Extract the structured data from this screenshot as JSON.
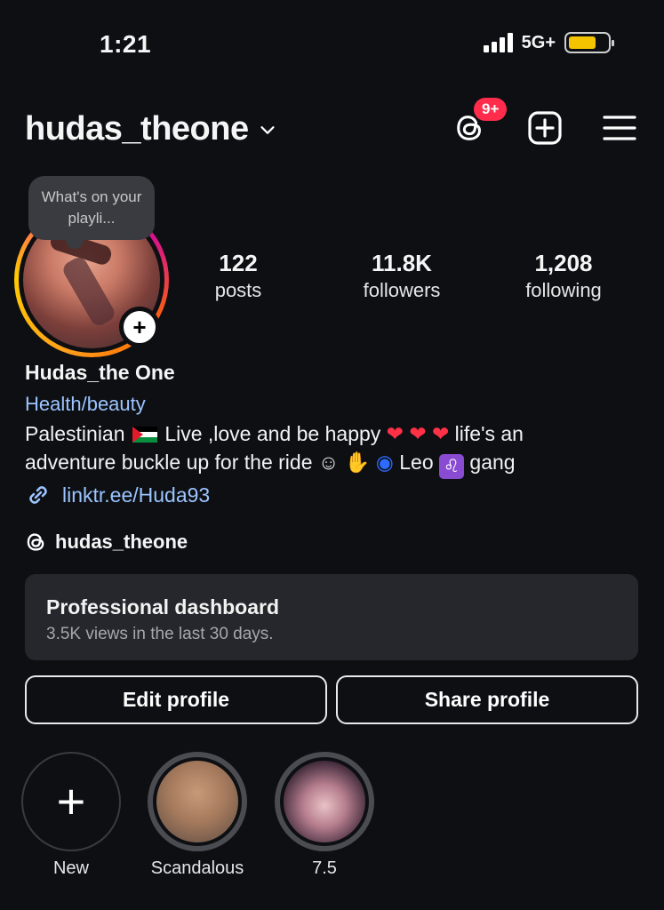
{
  "status_bar": {
    "time": "1:21",
    "network": "5G+",
    "battery_level": 0.55,
    "battery_color": "#f5c400"
  },
  "header": {
    "username": "hudas_theone",
    "notification_badge": "9+",
    "icons": [
      "threads-icon",
      "create-icon",
      "menu-icon"
    ]
  },
  "profile": {
    "note": "What's on your playli...",
    "stats": [
      {
        "value": "122",
        "label": "posts"
      },
      {
        "value": "11.8K",
        "label": "followers"
      },
      {
        "value": "1,208",
        "label": "following"
      }
    ],
    "display_name": "Hudas_the One",
    "category": "Health/beauty",
    "bio": {
      "line1_a": "Palestinian",
      "line1_b": "Live ,love and be happy",
      "line1_c": "life's an",
      "line2_a": "adventure buckle up for the ride",
      "line2_b": "Leo",
      "line2_c": "gang"
    },
    "link": "linktr.ee/Huda93",
    "threads_handle": "hudas_theone"
  },
  "dashboard": {
    "title": "Professional dashboard",
    "subtitle": "3.5K views in the last 30 days."
  },
  "buttons": {
    "edit": "Edit profile",
    "share": "Share profile"
  },
  "highlights": [
    {
      "label": "New"
    },
    {
      "label": "Scandalous"
    },
    {
      "label": "7.5"
    }
  ],
  "colors": {
    "background": "#0d0f13",
    "accent_link": "#9cc4ff",
    "badge": "#ff2d4b",
    "card": "#25272c"
  }
}
